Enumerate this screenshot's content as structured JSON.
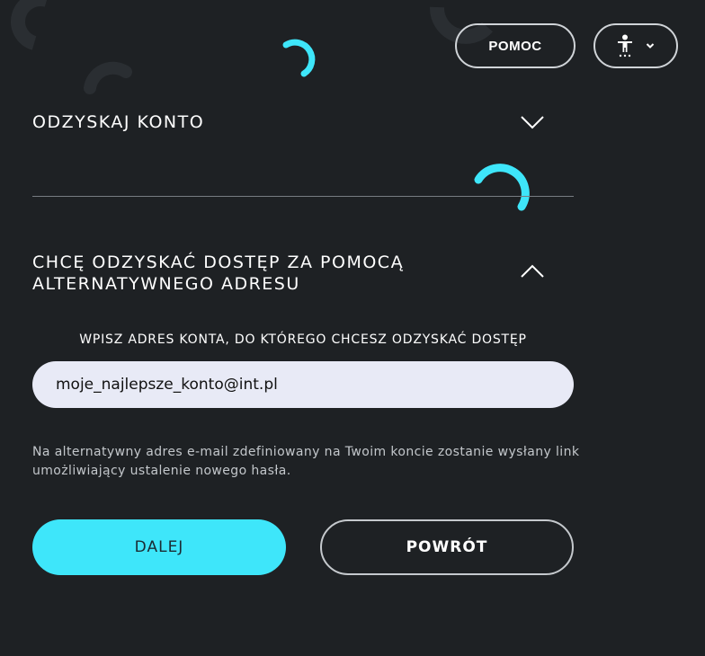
{
  "header": {
    "help_label": "POMOC",
    "accessibility_icon": "accessibility-icon",
    "dropdown_icon": "chevron-down-icon"
  },
  "sections": {
    "recover_account": {
      "title": "ODZYSKAJ KONTO",
      "icon": "chevron-down-icon"
    },
    "alternative_address": {
      "title": "CHCĘ ODZYSKAĆ DOSTĘP ZA POMOCĄ ALTERNATYWNEGO ADRESU",
      "icon": "chevron-up-icon"
    }
  },
  "form": {
    "field_label": "WPISZ ADRES KONTA, DO KTÓREGO CHCESZ ODZYSKAĆ DOSTĘP",
    "email_value": "moje_najlepsze_konto@int.pl",
    "info_text": "Na alternatywny adres e-mail zdefiniowany na Twoim koncie zostanie wysłany link umożliwiający ustalenie nowego hasła.",
    "next_label": "DALEJ",
    "back_label": "POWRÓT"
  },
  "colors": {
    "background": "#1e2124",
    "accent": "#3ee6fa",
    "input_bg": "#e8eaf6"
  }
}
